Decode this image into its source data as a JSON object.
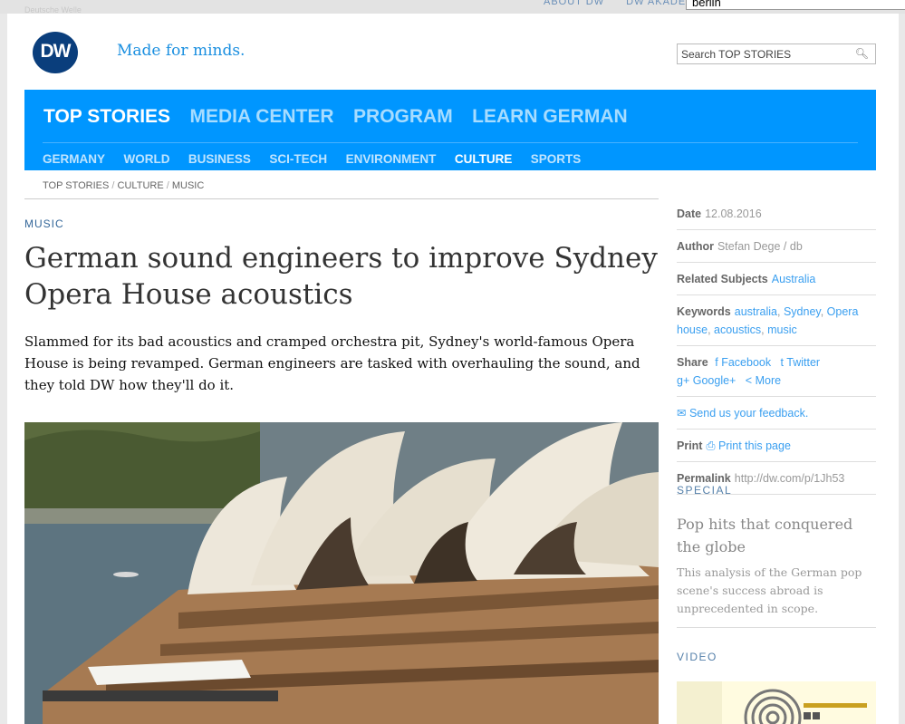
{
  "browser": {
    "search_value": "berlin",
    "top_links": [
      "ABOUT DW",
      "DW AKADE"
    ],
    "brand_small": "Deutsche Welle"
  },
  "header": {
    "logo": "DW",
    "tagline": "Made for minds.",
    "search_placeholder": "Search TOP STORIES"
  },
  "nav": {
    "main": [
      "TOP STORIES",
      "MEDIA CENTER",
      "PROGRAM",
      "LEARN GERMAN"
    ],
    "sub": [
      "GERMANY",
      "WORLD",
      "BUSINESS",
      "SCI-TECH",
      "ENVIRONMENT",
      "CULTURE",
      "SPORTS"
    ]
  },
  "breadcrumb": [
    "TOP STORIES",
    "CULTURE",
    "MUSIC"
  ],
  "article": {
    "section": "MUSIC",
    "title": "German sound engineers to improve Sydney Opera House acoustics",
    "lead": "Slammed for its bad acoustics and cramped orchestra pit, Sydney's world-famous Opera House is being revamped. German engineers are tasked with overhauling the sound, and they told DW how they'll do it."
  },
  "sidebar": {
    "date_label": "Date",
    "date": "12.08.2016",
    "author_label": "Author",
    "author": "Stefan Dege / db",
    "related_label": "Related Subjects",
    "related": "Australia",
    "keywords_label": "Keywords",
    "keywords": [
      "australia",
      "Sydney",
      "Opera house",
      "acoustics",
      "music"
    ],
    "share_label": "Share",
    "share": [
      "Facebook",
      "Twitter",
      "Google+",
      "More"
    ],
    "feedback": "Send us your feedback.",
    "print_label": "Print",
    "print": "Print this page",
    "permalink_label": "Permalink",
    "permalink": "http://dw.com/p/1Jh53"
  },
  "special": {
    "heading": "SPECIAL",
    "title": "Pop hits that conquered the globe",
    "desc": "This analysis of the German pop scene's success abroad is unprecedented in scope."
  },
  "video": {
    "heading": "VIDEO"
  }
}
